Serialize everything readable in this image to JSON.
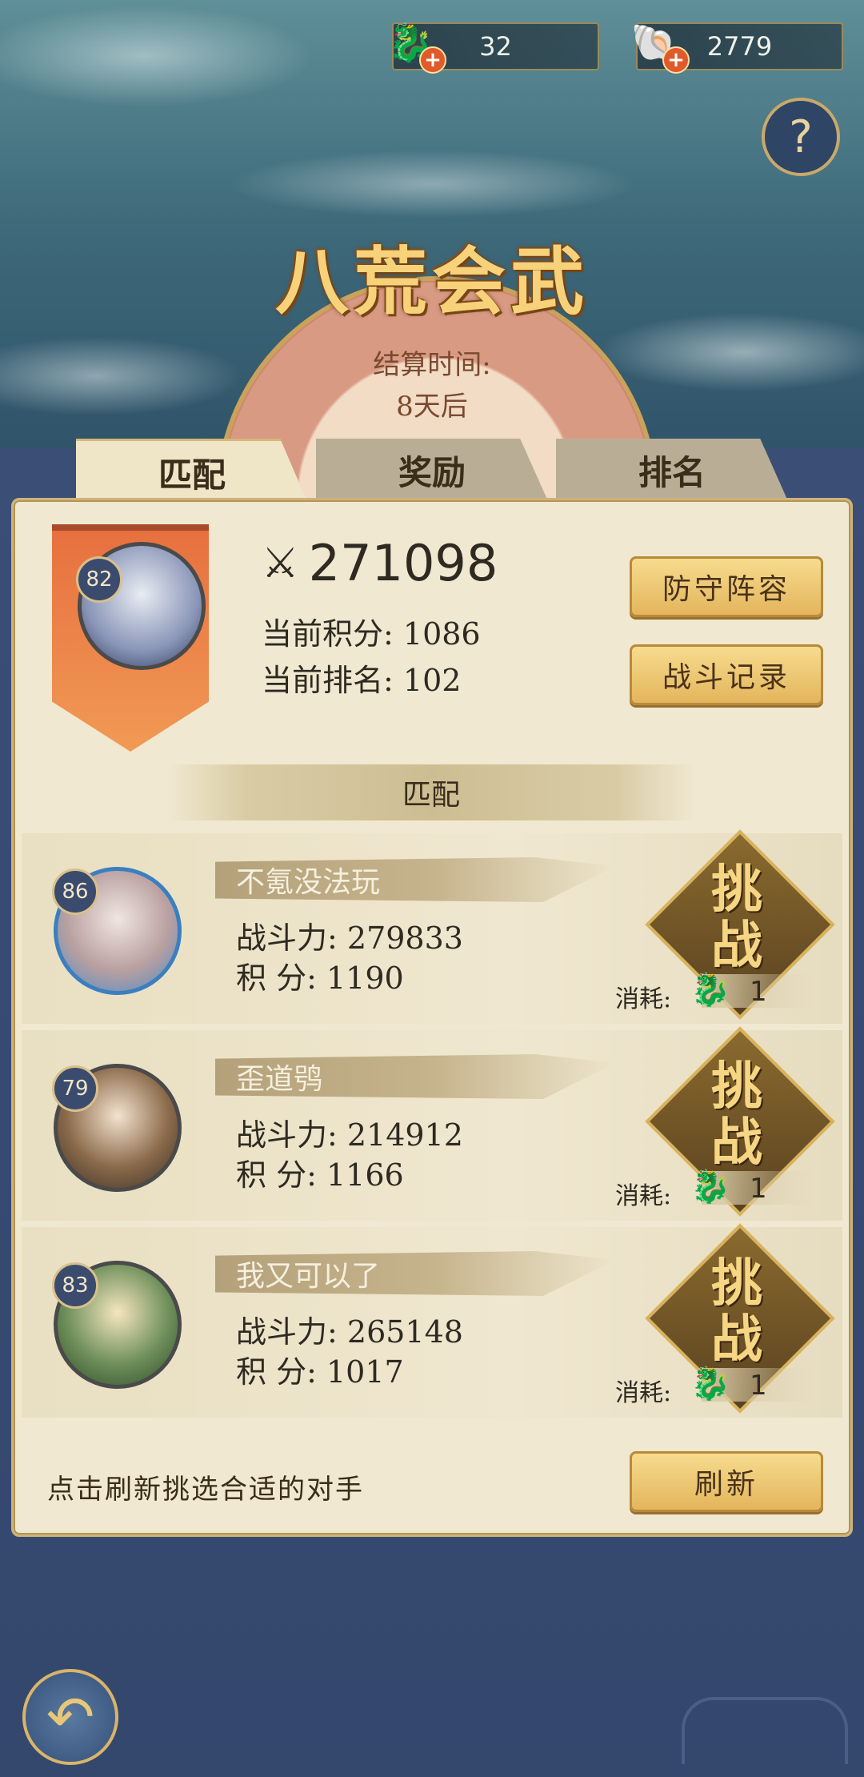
{
  "currencies": [
    {
      "icon": "gold-dragon-icon",
      "value": "32"
    },
    {
      "icon": "jade-shell-icon",
      "value": "2779"
    }
  ],
  "title": "八荒会武",
  "settlement": {
    "label": "结算时间:",
    "value": "8天后"
  },
  "tabs": [
    {
      "label": "匹配",
      "active": true
    },
    {
      "label": "奖励",
      "active": false
    },
    {
      "label": "排名",
      "active": false
    }
  ],
  "player": {
    "level": "82",
    "power": "271098",
    "score_label": "当前积分:",
    "score": "1086",
    "rank_label": "当前排名:",
    "rank": "102"
  },
  "buttons": {
    "defense": "防守阵容",
    "records": "战斗记录",
    "refresh": "刷新"
  },
  "match_section_label": "匹配",
  "opponents": [
    {
      "level": "86",
      "name": "不氪没法玩",
      "power_label": "战斗力:",
      "power": "279833",
      "score_label": "积 分:",
      "score": "1190",
      "cost": "1"
    },
    {
      "level": "79",
      "name": "歪道鸮",
      "power_label": "战斗力:",
      "power": "214912",
      "score_label": "积 分:",
      "score": "1166",
      "cost": "1"
    },
    {
      "level": "83",
      "name": "我又可以了",
      "power_label": "战斗力:",
      "power": "265148",
      "score_label": "积 分:",
      "score": "1017",
      "cost": "1"
    }
  ],
  "challenge_label": "挑战",
  "cost_label": "消耗:",
  "hint": "点击刷新挑选合适的对手",
  "colors": {
    "accent_gold": "#f7d27a",
    "panel": "#f0e8d0",
    "banner": "#e7703f",
    "background": "#3a4e76"
  }
}
